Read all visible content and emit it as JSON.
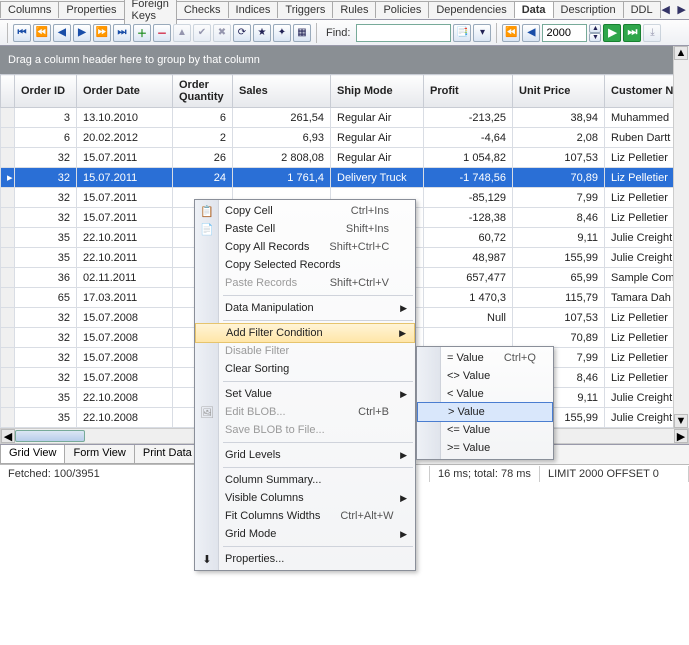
{
  "tabs": [
    "Columns",
    "Properties",
    "Foreign Keys",
    "Checks",
    "Indices",
    "Triggers",
    "Rules",
    "Policies",
    "Dependencies",
    "Data",
    "Description",
    "DDL"
  ],
  "active_tab": "Data",
  "toolbar": {
    "find_label": "Find:",
    "find_value": "",
    "limit_value": "2000"
  },
  "group_hint": "Drag a column header here to group by that column",
  "columns": [
    "Order ID",
    "Order Date",
    "Order Quantity",
    "Sales",
    "Ship Mode",
    "Profit",
    "Unit Price",
    "Customer N"
  ],
  "rows": [
    {
      "oid": "3",
      "od": "13.10.2010",
      "oq": "6",
      "sales": "261,54",
      "ship": "Regular Air",
      "profit": "-213,25",
      "up": "38,94",
      "cust": "Muhammed"
    },
    {
      "oid": "6",
      "od": "20.02.2012",
      "oq": "2",
      "sales": "6,93",
      "ship": "Regular Air",
      "profit": "-4,64",
      "up": "2,08",
      "cust": "Ruben Dartt"
    },
    {
      "oid": "32",
      "od": "15.07.2011",
      "oq": "26",
      "sales": "2 808,08",
      "ship": "Regular Air",
      "profit": "1 054,82",
      "up": "107,53",
      "cust": "Liz Pelletier"
    },
    {
      "oid": "32",
      "od": "15.07.2011",
      "oq": "24",
      "sales": "1 761,4",
      "ship": "Delivery Truck",
      "profit": "-1 748,56",
      "up": "70,89",
      "cust": "Liz Pelletier",
      "sel": true,
      "ind": "▸"
    },
    {
      "oid": "32",
      "od": "15.07.2011",
      "oq": "",
      "sales": "",
      "ship": "",
      "profit": "-85,129",
      "up": "7,99",
      "cust": "Liz Pelletier"
    },
    {
      "oid": "32",
      "od": "15.07.2011",
      "oq": "",
      "sales": "",
      "ship": "",
      "profit": "-128,38",
      "up": "8,46",
      "cust": "Liz Pelletier"
    },
    {
      "oid": "35",
      "od": "22.10.2011",
      "oq": "",
      "sales": "",
      "ship": "",
      "profit": "60,72",
      "up": "9,11",
      "cust": "Julie Creight"
    },
    {
      "oid": "35",
      "od": "22.10.2011",
      "oq": "",
      "sales": "",
      "ship": "",
      "profit": "48,987",
      "up": "155,99",
      "cust": "Julie Creight"
    },
    {
      "oid": "36",
      "od": "02.11.2011",
      "oq": "",
      "sales": "",
      "ship": "",
      "profit": "657,477",
      "up": "65,99",
      "cust": "Sample Com"
    },
    {
      "oid": "65",
      "od": "17.03.2011",
      "oq": "",
      "sales": "",
      "ship": "",
      "profit": "1 470,3",
      "up": "115,79",
      "cust": "Tamara Dah"
    },
    {
      "oid": "32",
      "od": "15.07.2008",
      "oq": "",
      "sales": "",
      "ship": "",
      "profit": "Null",
      "up": "107,53",
      "cust": "Liz Pelletier"
    },
    {
      "oid": "32",
      "od": "15.07.2008",
      "oq": "",
      "sales": "",
      "ship": "",
      "profit": "",
      "up": "70,89",
      "cust": "Liz Pelletier"
    },
    {
      "oid": "32",
      "od": "15.07.2008",
      "oq": "",
      "sales": "",
      "ship": "",
      "profit": "",
      "up": "7,99",
      "cust": "Liz Pelletier"
    },
    {
      "oid": "32",
      "od": "15.07.2008",
      "oq": "",
      "sales": "",
      "ship": "",
      "profit": "",
      "up": "8,46",
      "cust": "Liz Pelletier"
    },
    {
      "oid": "35",
      "od": "22.10.2008",
      "oq": "",
      "sales": "",
      "ship": "",
      "profit": "",
      "up": "9,11",
      "cust": "Julie Creight"
    },
    {
      "oid": "35",
      "od": "22.10.2008",
      "oq": "",
      "sales": "",
      "ship": "",
      "profit": "",
      "up": "155,99",
      "cust": "Julie Creight"
    }
  ],
  "bottom_tabs": [
    "Grid View",
    "Form View",
    "Print Data"
  ],
  "active_bottom_tab": "Grid View",
  "status": {
    "fetched": "Fetched: 100/3951",
    "time": "16 ms; total: 78 ms",
    "limit": "LIMIT 2000 OFFSET 0"
  },
  "ctx": {
    "items": [
      {
        "label": "Copy Cell",
        "sc": "Ctrl+Ins",
        "icon": "📋"
      },
      {
        "label": "Paste Cell",
        "sc": "Shift+Ins",
        "icon": "📄"
      },
      {
        "label": "Copy All Records",
        "sc": "Shift+Ctrl+C"
      },
      {
        "label": "Copy Selected Records"
      },
      {
        "label": "Paste Records",
        "sc": "Shift+Ctrl+V",
        "disabled": true
      },
      {
        "sep": true
      },
      {
        "label": "Data Manipulation",
        "sub": true
      },
      {
        "sep": true
      },
      {
        "label": "Add Filter Condition",
        "sub": true,
        "hl": true
      },
      {
        "label": "Disable Filter",
        "disabled": true
      },
      {
        "label": "Clear Sorting"
      },
      {
        "sep": true
      },
      {
        "label": "Set Value",
        "sub": true
      },
      {
        "label": "Edit BLOB...",
        "sc": "Ctrl+B",
        "disabled": true,
        "icon": "🖼"
      },
      {
        "label": "Save BLOB to File...",
        "disabled": true
      },
      {
        "sep": true
      },
      {
        "label": "Grid Levels",
        "sub": true
      },
      {
        "sep": true
      },
      {
        "label": "Column Summary..."
      },
      {
        "label": "Visible Columns",
        "sub": true
      },
      {
        "label": "Fit Columns Widths",
        "sc": "Ctrl+Alt+W"
      },
      {
        "label": "Grid Mode",
        "sub": true
      },
      {
        "sep": true
      },
      {
        "label": "Properties...",
        "icon": "⬇"
      }
    ],
    "sub": [
      {
        "label": "= Value",
        "sc": "Ctrl+Q"
      },
      {
        "label": "<> Value"
      },
      {
        "label": "< Value"
      },
      {
        "label": "> Value",
        "hl": true
      },
      {
        "label": "<= Value"
      },
      {
        "label": ">= Value"
      }
    ]
  }
}
